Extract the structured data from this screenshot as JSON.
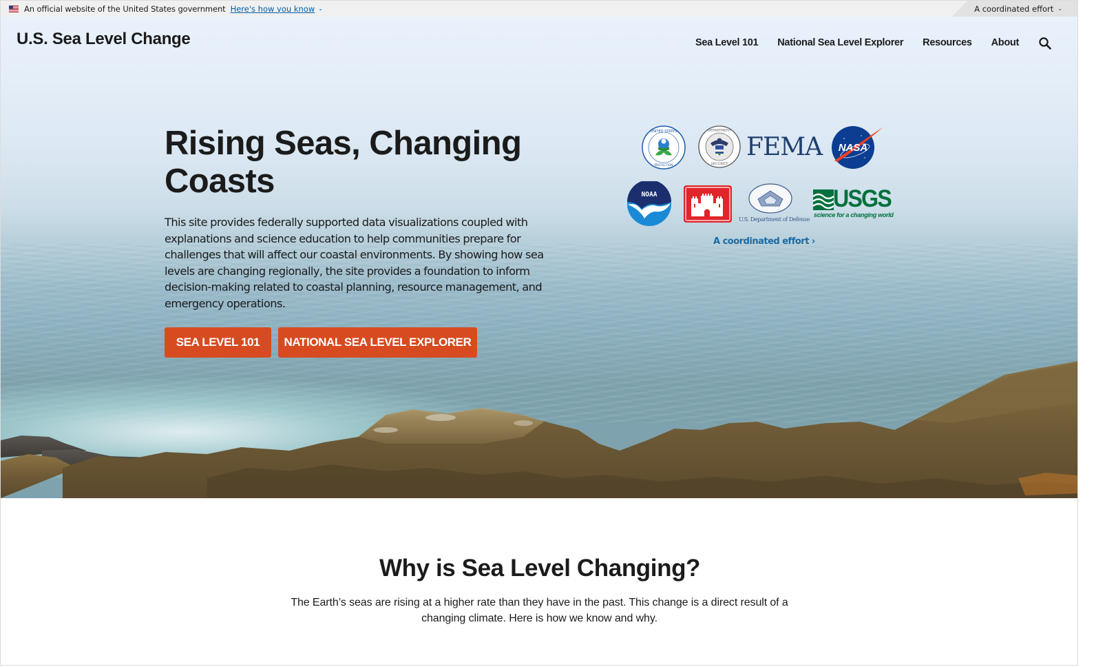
{
  "gov_banner": {
    "text": "An official website of the United States government",
    "link": "Here's how you know",
    "coordinated": "A coordinated effort"
  },
  "header": {
    "site_title": "U.S. Sea Level Change",
    "nav": [
      "Sea Level 101",
      "National Sea Level Explorer",
      "Resources",
      "About"
    ],
    "search_icon": "search-icon"
  },
  "hero": {
    "title": "Rising Seas, Changing Coasts",
    "description": "This site provides federally supported data visualizations coupled with explanations and science education to help communities prepare for challenges that will affect our coastal environments. By showing how sea levels are changing regionally, the site provides a foundation to inform decision-making related to coastal planning, resource management, and emergency operations.",
    "buttons": [
      "SEA LEVEL 101",
      "NATIONAL SEA LEVEL EXPLORER"
    ],
    "agencies": {
      "epa": "United States Environmental Protection Agency",
      "dhs": "U.S. Department of Homeland Security",
      "fema": "FEMA",
      "nasa": "NASA",
      "noaa": "NOAA",
      "usace": "U.S. Army Corps of Engineers",
      "dod": "U.S. Department of Defense",
      "usgs": "USGS",
      "usgs_tagline": "science for a changing world"
    },
    "coordinated_link": "A coordinated effort ›"
  },
  "why": {
    "title": "Why is Sea Level Changing?",
    "text": "The Earth’s seas are rising at a higher rate than they have in the past. This change is a direct result of a changing climate. Here is how we know and why."
  },
  "colors": {
    "accent": "#d84b20",
    "link": "#005ea2",
    "text": "#1b1b1b"
  }
}
